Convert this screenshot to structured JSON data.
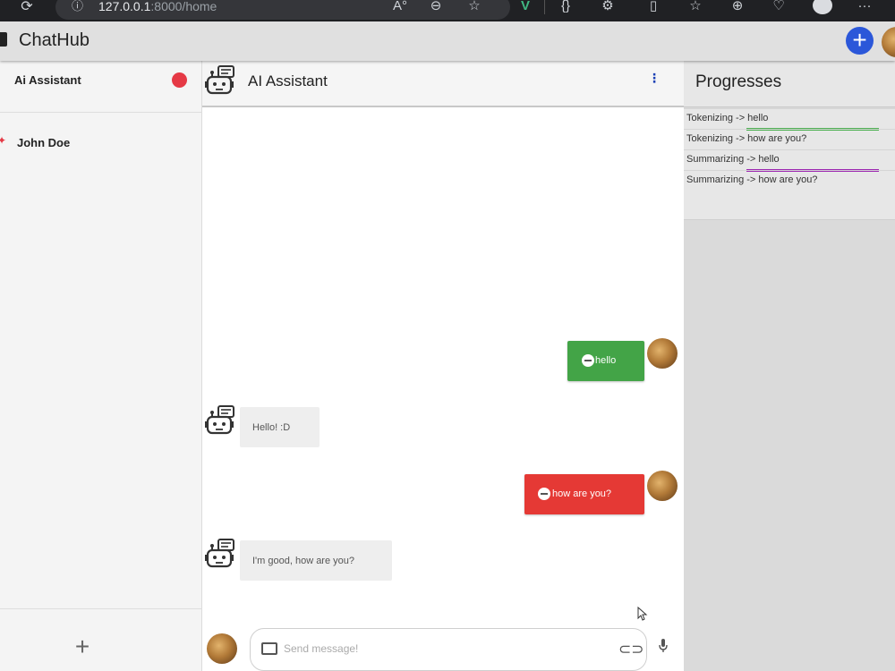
{
  "browser": {
    "url_host": "127.0.0.1",
    "url_rest": ":8000/home",
    "info_glyph": "ⓘ",
    "reload_glyph": "⟳",
    "toolbar_glyphs": [
      "A°",
      "⊖",
      "☆",
      "V",
      "{}",
      "⚙",
      "▯",
      "☆",
      "⊕",
      "♡",
      "···"
    ]
  },
  "app": {
    "title": "ChatHub",
    "add_glyph": "+"
  },
  "sidebar": {
    "contacts": [
      {
        "name": "Ai Assistant",
        "status_color": "#e53945"
      },
      {
        "name": "John Doe"
      }
    ],
    "add_glyph": "+"
  },
  "chat": {
    "title": "AI Assistant",
    "menu_glyph": "⋮",
    "messages": [
      {
        "side": "out",
        "text": "hello",
        "color": "#43a447"
      },
      {
        "side": "in",
        "text": "Hello! :D"
      },
      {
        "side": "out",
        "text": "how are you?",
        "color": "#e53935"
      },
      {
        "side": "in",
        "text": "I'm good, how are you?"
      }
    ],
    "composer": {
      "placeholder": "Send message!",
      "link_glyph": "⊂⊃"
    }
  },
  "progress": {
    "title": "Progresses",
    "items": [
      {
        "label": "Tokenizing -> hello",
        "fraction": 1.0,
        "color": "#4caf50"
      },
      {
        "label": "Tokenizing -> how are you?",
        "fraction": 0
      },
      {
        "label": "Summarizing -> hello",
        "fraction": 1.0,
        "color": "#9c27b0"
      },
      {
        "label": "Summarizing -> how are you?",
        "fraction": 0
      }
    ]
  }
}
